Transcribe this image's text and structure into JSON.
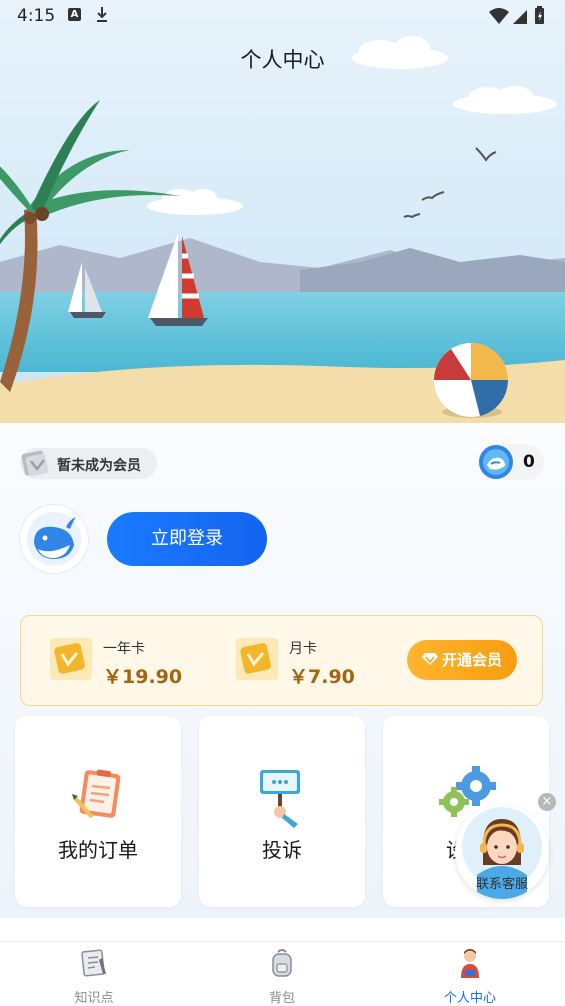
{
  "status_bar": {
    "time": "4:15",
    "icons": [
      "a-notification-icon",
      "download-icon",
      "wifi-icon",
      "signal-icon",
      "battery-icon"
    ]
  },
  "header": {
    "title": "个人中心"
  },
  "member": {
    "status": "暂未成为会员",
    "coins": "0"
  },
  "login": {
    "label": "立即登录"
  },
  "vip": {
    "plans": [
      {
        "name": "一年卡",
        "price": "￥19.90"
      },
      {
        "name": "月卡",
        "price": "￥7.90"
      }
    ],
    "open_label": "开通会员",
    "colors": {
      "accent": "#f7a21a",
      "card_bg": "#fff8e9",
      "price": "#a3650f"
    }
  },
  "tiles": [
    {
      "label": "我的订单",
      "icon": "order-clipboard-icon"
    },
    {
      "label": "投诉",
      "icon": "complaint-sign-icon"
    },
    {
      "label": "设",
      "icon": "settings-gears-icon"
    }
  ],
  "customer_service": {
    "label": "联系客服"
  },
  "tabs": [
    {
      "label": "知识点",
      "icon": "knowledge-doc-icon"
    },
    {
      "label": "背包",
      "icon": "backpack-icon"
    },
    {
      "label": "个人中心",
      "icon": "profile-person-icon",
      "active": true
    }
  ],
  "colors": {
    "primary": "#1a6cf0",
    "sky": "#cfe6f6",
    "sea": "#57c0d9",
    "sand": "#f4ddaa"
  }
}
